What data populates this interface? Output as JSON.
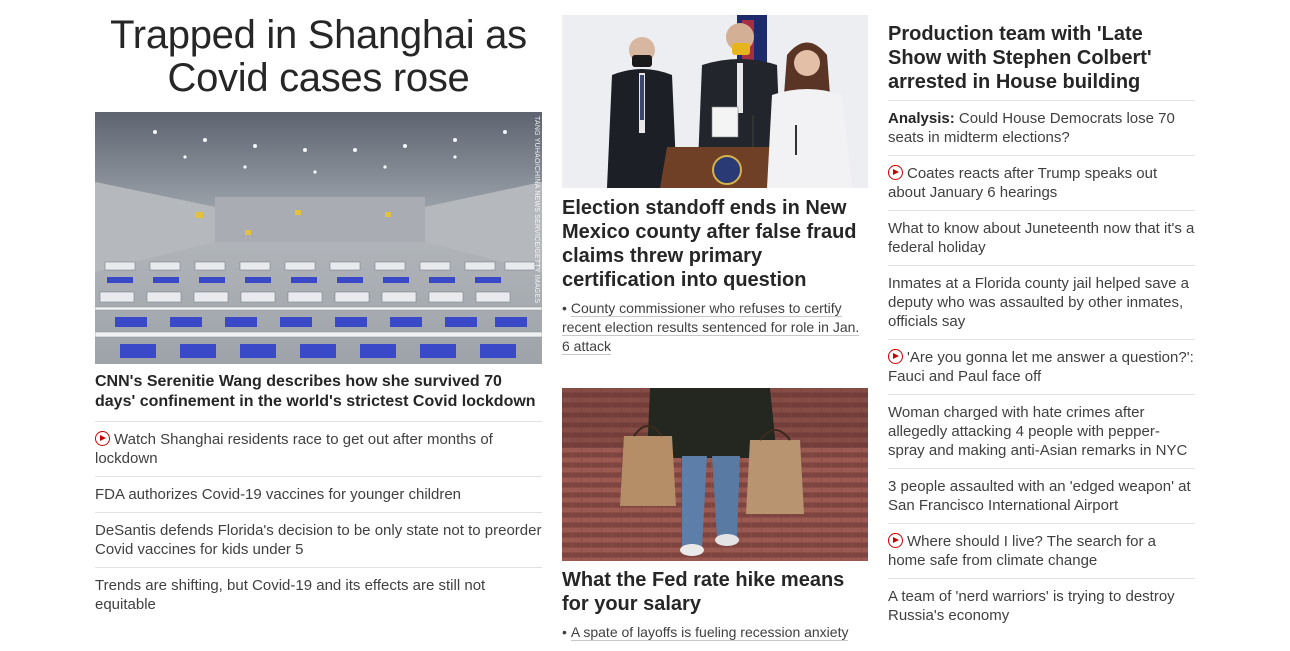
{
  "left": {
    "title": "Trapped in Shanghai as Covid cases rose",
    "image_credit": "TANG YUHAO/CHINA NEWS SERVICE/GETTY IMAGES",
    "hero_caption": "CNN's Serenitie Wang describes how she survived 70 days' confinement in the world's strictest Covid lockdown",
    "links": [
      {
        "text": "Watch Shanghai residents race to get out after months of lockdown",
        "video": true
      },
      {
        "text": "FDA authorizes Covid-19 vaccines for younger children",
        "video": false
      },
      {
        "text": "DeSantis defends Florida's decision to be only state not to preorder Covid vaccines for kids under 5",
        "video": false
      },
      {
        "text": "Trends are shifting, but Covid-19 and its effects are still not equitable",
        "video": false
      }
    ]
  },
  "middle": {
    "story1": {
      "headline": "Election standoff ends in New Mexico county after false fraud claims threw primary certification into question",
      "bullet": "•",
      "sublink": "County commissioner who refuses to certify recent election results sentenced for role in Jan. 6 attack"
    },
    "story2": {
      "headline": "What the Fed rate hike means for your salary",
      "bullet": "•",
      "sublink": "A spate of layoffs is fueling recession anxiety"
    }
  },
  "right": {
    "headline": "Production team with 'Late Show with Stephen Colbert' arrested in House building",
    "links": [
      {
        "prefix": "Analysis:",
        "text": " Could House Democrats lose 70 seats in midterm elections?",
        "video": false
      },
      {
        "prefix": "",
        "text": "Coates reacts after Trump speaks out about January 6 hearings",
        "video": true
      },
      {
        "prefix": "",
        "text": "What to know about Juneteenth now that it's a federal holiday",
        "video": false
      },
      {
        "prefix": "",
        "text": "Inmates at a Florida county jail helped save a deputy who was assaulted by other inmates, officials say",
        "video": false
      },
      {
        "prefix": "",
        "text": "'Are you gonna let me answer a question?': Fauci and Paul face off",
        "video": true
      },
      {
        "prefix": "",
        "text": "Woman charged with hate crimes after allegedly attacking 4 people with pepper-spray and making anti-Asian remarks in NYC",
        "video": false
      },
      {
        "prefix": "",
        "text": "3 people assaulted with an 'edged weapon' at San Francisco International Airport",
        "video": false
      },
      {
        "prefix": "",
        "text": "Where should I live? The search for a home safe from climate change",
        "video": true
      },
      {
        "prefix": "",
        "text": "A team of 'nerd warriors' is trying to destroy Russia's economy",
        "video": false
      }
    ]
  },
  "colors": {
    "video_icon": "#cc0000",
    "text": "#262626",
    "divider": "#e1e1e1"
  }
}
